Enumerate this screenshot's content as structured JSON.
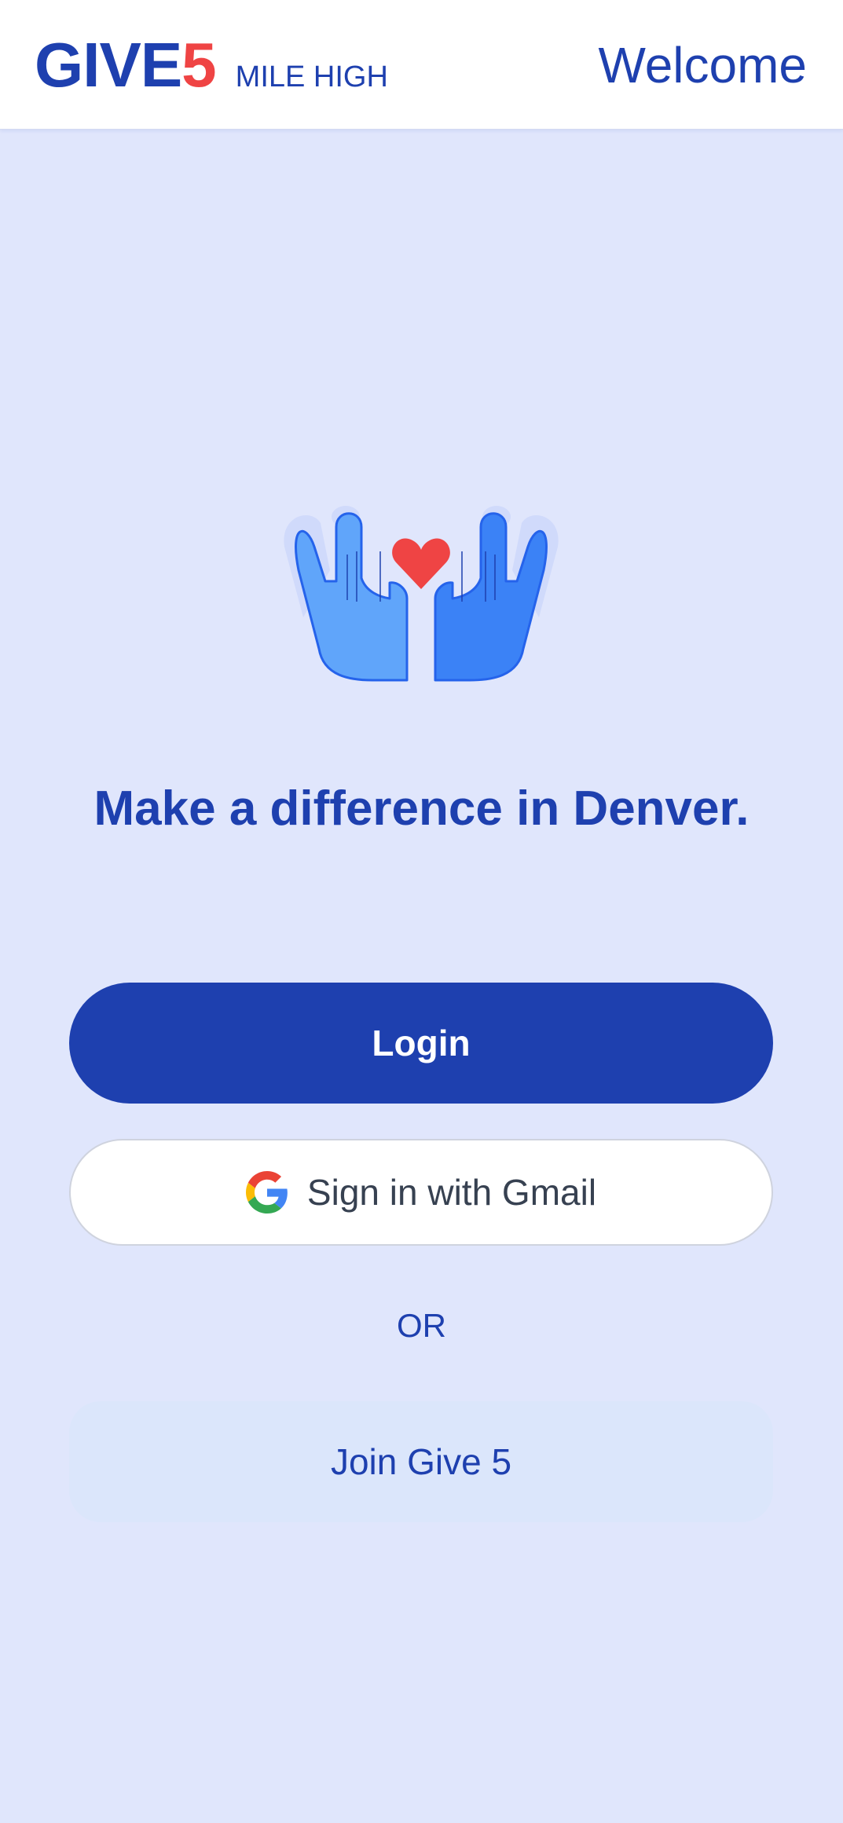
{
  "header": {
    "logo_give": "GIVE",
    "logo_five": "5",
    "logo_sub": "MILE HIGH",
    "title": "Welcome"
  },
  "hero": {
    "illustration_icon": "hands-heart-icon",
    "tagline": "Make a difference in Denver."
  },
  "auth": {
    "login_label": "Login",
    "gmail_label": "Sign in with Gmail",
    "gmail_icon": "google-icon",
    "or_label": "OR",
    "join_label": "Join Give 5"
  },
  "colors": {
    "brand_blue": "#1e40af",
    "accent_red": "#ef4444",
    "background": "#e0e6fc",
    "join_bg": "#dbe6fb"
  }
}
